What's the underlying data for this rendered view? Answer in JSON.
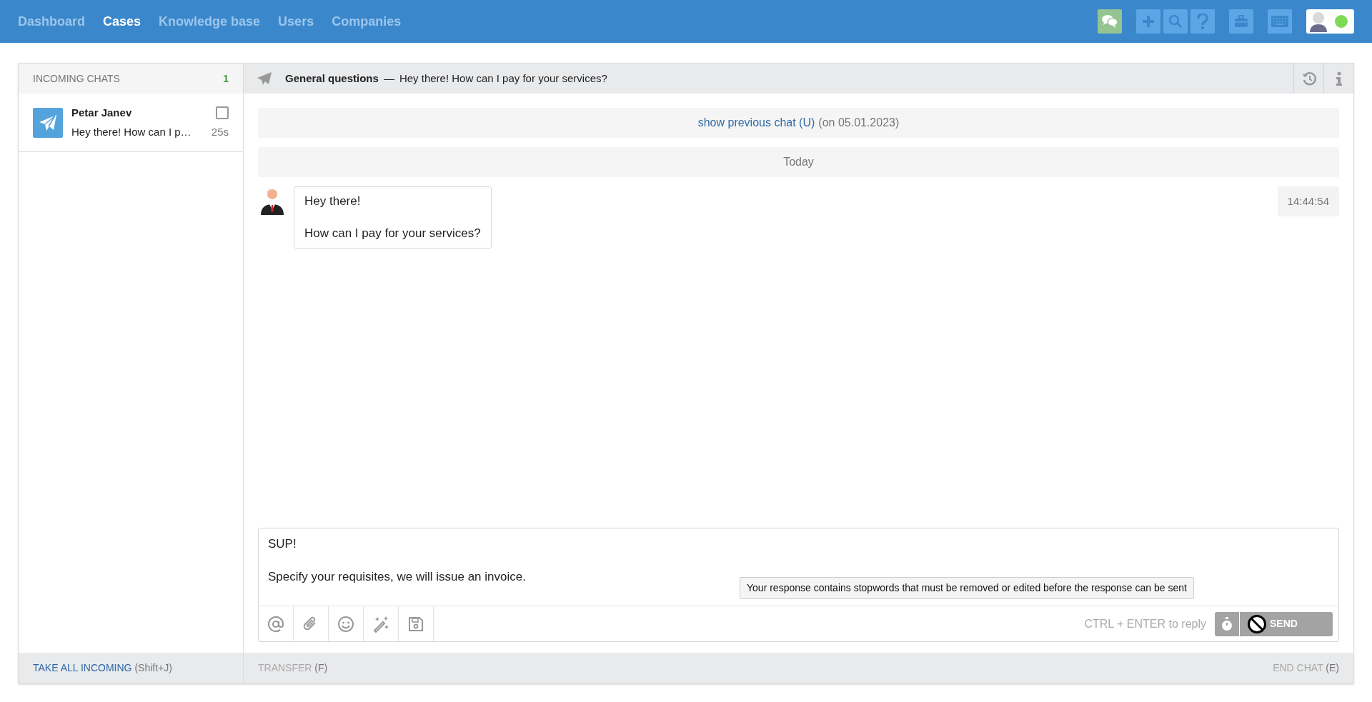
{
  "nav": {
    "items": [
      {
        "label": "Dashboard",
        "selected": false
      },
      {
        "label": "Cases",
        "selected": true
      },
      {
        "label": "Knowledge base",
        "selected": false
      },
      {
        "label": "Users",
        "selected": false
      },
      {
        "label": "Companies",
        "selected": false
      }
    ],
    "user_online": true
  },
  "incoming": {
    "title": "INCOMING CHATS",
    "count": "1",
    "chats": [
      {
        "name": "Petar Janev",
        "preview": "Hey there! How can I p…",
        "time": "25s",
        "checked": false
      }
    ]
  },
  "conversation": {
    "topic": "General questions",
    "dash": "—",
    "subject": "Hey there! How can I pay for your services?",
    "previous_chat": {
      "link": "show previous chat (U)",
      "date": "(on 05.01.2023)"
    },
    "day_label": "Today",
    "messages": [
      {
        "lines": [
          "Hey there!",
          "How can I pay for your services?"
        ],
        "time": "14:44:54"
      }
    ],
    "composer": {
      "value": "SUP!\n\nSpecify your requisites, we will issue an invoice.",
      "warning": "Your response contains stopwords that must be removed or edited before the response can be sent",
      "hint": "CTRL + ENTER to reply",
      "send_label": "SEND",
      "send_disabled": true
    }
  },
  "footer": {
    "take_all": {
      "label": "TAKE ALL INCOMING",
      "shortcut": "(Shift+J)"
    },
    "transfer": {
      "label": "TRANSFER",
      "shortcut": "(F)"
    },
    "end_chat": {
      "label": "END CHAT",
      "shortcut": "(E)"
    }
  }
}
